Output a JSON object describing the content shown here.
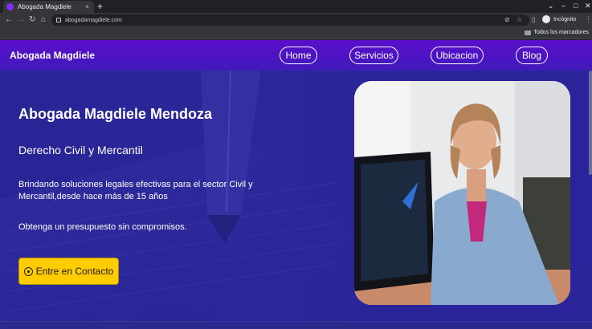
{
  "browser": {
    "tab_title": "Abogada Magdiele",
    "tab_close": "×",
    "new_tab": "+",
    "url": "abogadamagdiele.com",
    "incognito_label": "Incógnito",
    "bookmarks_label": "Todos los marcadores",
    "icons": {
      "back": "←",
      "forward": "→",
      "reload": "↻",
      "home": "⌂",
      "eye_off": "⊘",
      "star": "☆",
      "sidepanel": "▯",
      "menu": "⋮",
      "chevron": "⌄",
      "minimize": "–",
      "maximize": "□",
      "close": "✕"
    }
  },
  "site": {
    "brand": "Abogada Magdiele",
    "nav": [
      {
        "label": "Home"
      },
      {
        "label": "Servicios"
      },
      {
        "label": "Ubicacion"
      },
      {
        "label": "Blog"
      }
    ],
    "hero": {
      "title": "Abogada Magdiele Mendoza",
      "subtitle": "Derecho Civil y Mercantil",
      "description": "Brindando soluciones legales efectivas para el sector Civil y Mercantil,desde hace más de 15 años",
      "offer": "Obtenga un presupuesto sin compromisos.",
      "cta_label": "Entre en Contacto"
    },
    "colors": {
      "nav_gradient_start": "#5b0fc9",
      "hero_bg": "#2a2596",
      "cta_bg": "#ffcc00"
    }
  }
}
